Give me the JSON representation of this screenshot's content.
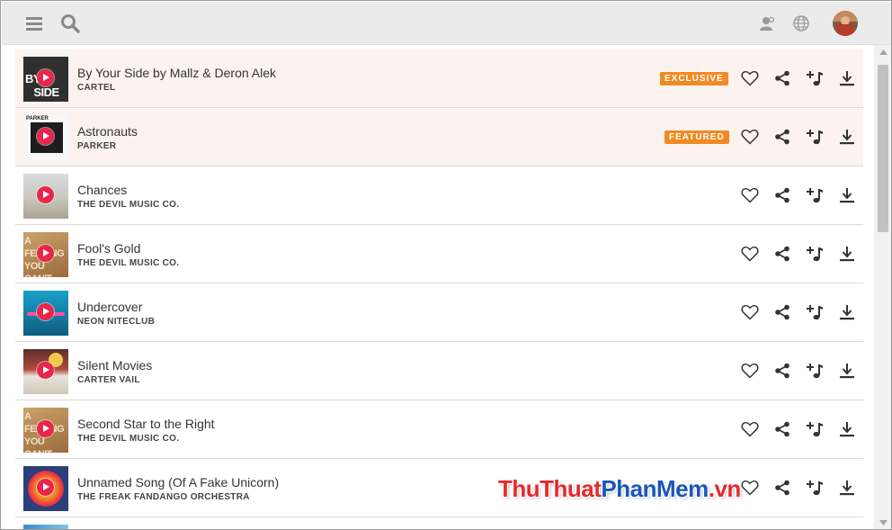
{
  "header": {
    "menu_icon": "hamburger-menu-icon",
    "search_icon": "search-icon",
    "user_icon": "user-icon",
    "globe_icon": "globe-icon",
    "avatar": "avatar"
  },
  "tracks": [
    {
      "title": "By Your Side by Mallz & Deron Alek",
      "artist": "CARTEL",
      "badge": "EXCLUSIVE",
      "highlight": true
    },
    {
      "title": "Astronauts",
      "artist": "PARKER",
      "badge": "FEATURED",
      "highlight": true
    },
    {
      "title": "Chances",
      "artist": "THE DEVIL MUSIC CO.",
      "badge": "",
      "highlight": false
    },
    {
      "title": "Fool's Gold",
      "artist": "THE DEVIL MUSIC CO.",
      "badge": "",
      "highlight": false
    },
    {
      "title": "Undercover",
      "artist": "NEON NITECLUB",
      "badge": "",
      "highlight": false
    },
    {
      "title": "Silent Movies",
      "artist": "CARTER VAIL",
      "badge": "",
      "highlight": false
    },
    {
      "title": "Second Star to the Right",
      "artist": "THE DEVIL MUSIC CO.",
      "badge": "",
      "highlight": false
    },
    {
      "title": "Unnamed Song (Of A Fake Unicorn)",
      "artist": "THE FREAK FANDANGO ORCHESTRA",
      "badge": "",
      "highlight": false
    }
  ],
  "actions": [
    "heart-icon",
    "share-icon",
    "add-to-playlist-icon",
    "download-icon"
  ],
  "watermark": {
    "part1": "ThuThuat",
    "part2": "PhanMem",
    "part3": ".vn"
  },
  "colors": {
    "badge": "#f08a24",
    "play": "#e8254b",
    "highlight_row": "#fdf3ee"
  }
}
